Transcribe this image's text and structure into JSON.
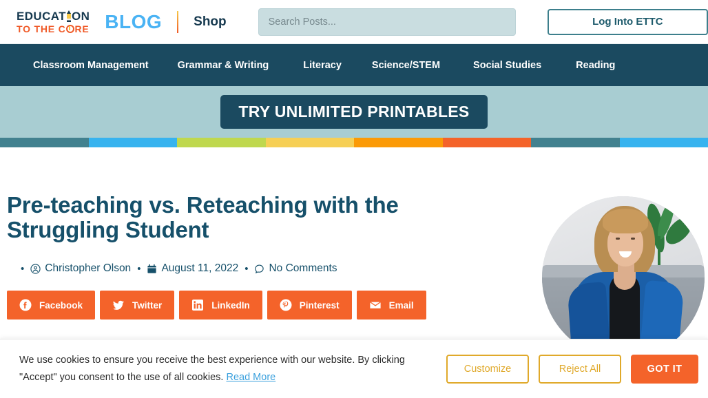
{
  "header": {
    "logo": {
      "main_pre": "EDUCAT",
      "main_post": "ON",
      "sub_pre": "TO THE C",
      "sub_post": "RE"
    },
    "blog_label": "BLOG",
    "shop_label": "Shop",
    "search": {
      "placeholder": "Search Posts...",
      "value": "",
      "icon": "search-icon"
    },
    "login_label": "Log Into ETTC"
  },
  "nav": {
    "items": [
      {
        "label": "Classroom Management"
      },
      {
        "label": "Grammar & Writing"
      },
      {
        "label": "Literacy"
      },
      {
        "label": "Science/STEM"
      },
      {
        "label": "Social Studies"
      },
      {
        "label": "Reading"
      }
    ]
  },
  "promo": {
    "label": "TRY UNLIMITED PRINTABLES"
  },
  "stripe": {
    "colors": [
      "#42818f",
      "#37b3ef",
      "#bfd84e",
      "#f6cf55",
      "#fb9a06",
      "#f4632a",
      "#42818f",
      "#37b3ef"
    ]
  },
  "article": {
    "title": "Pre-teaching vs. Reteaching with the Struggling Student",
    "meta": {
      "bullet": "•",
      "author": {
        "icon": "user-circle-icon",
        "label": "Christopher Olson"
      },
      "date": {
        "icon": "calendar-icon",
        "label": "August 11, 2022"
      },
      "comments": {
        "icon": "comment-icon",
        "label": "No Comments"
      }
    },
    "share": [
      {
        "icon": "facebook-icon",
        "label": "Facebook"
      },
      {
        "icon": "twitter-icon",
        "label": "Twitter"
      },
      {
        "icon": "linkedin-icon",
        "label": "LinkedIn"
      },
      {
        "icon": "pinterest-icon",
        "label": "Pinterest"
      },
      {
        "icon": "email-icon",
        "label": "Email"
      }
    ],
    "author_photo_alt": "author-headshot"
  },
  "cookie": {
    "line1": "We use cookies to ensure you receive the best experience with our website.  By clicking \"Accept\"",
    "line2": "you consent to the use of all cookies.",
    "read_more": "Read More",
    "customize_label": "Customize",
    "reject_label": "Reject All",
    "accept_label": "GOT IT"
  },
  "colors": {
    "navy": "#1b4a60",
    "title_blue": "#16506a",
    "orange": "#f4632a",
    "blog_blue": "#4ab3f4",
    "promo_bg": "#a8cdd2",
    "gold": "#e0a92a"
  }
}
